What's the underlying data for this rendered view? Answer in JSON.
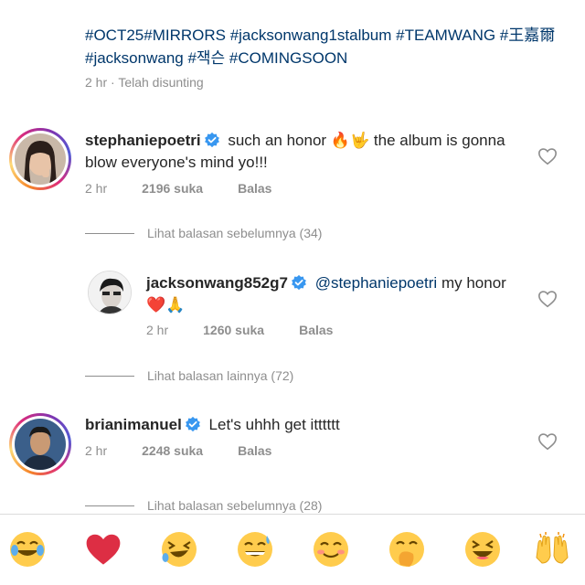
{
  "post": {
    "caption_hashtags": "#OCT25#MIRRORS #jacksonwang1stalbum #TEAMWANG #王嘉爾 #jacksonwang #잭슨 #COMINGSOON",
    "meta": "2 hr · Telah disunting"
  },
  "comments": [
    {
      "username": "stephaniepoetri",
      "text_before": "such an honor",
      "emoji_inline": "🔥🤟",
      "text_after": "the album is gonna blow everyone's mind yo!!!",
      "time": "2 hr",
      "likes": "2196 suka",
      "reply_label": "Balas"
    },
    {
      "username": "jacksonwang852g7",
      "mention": "@stephaniepoetri",
      "text": "my honor",
      "emoji_inline": "❤️🙏",
      "time": "2 hr",
      "likes": "1260 suka",
      "reply_label": "Balas"
    },
    {
      "username": "brianimanuel",
      "text": "Let's uhhh get itttttt",
      "time": "2 hr",
      "likes": "2248 suka",
      "reply_label": "Balas"
    }
  ],
  "view_replies": {
    "previous_1": "Lihat balasan sebelumnya (34)",
    "more": "Lihat balasan lainnya (72)",
    "previous_2": "Lihat balasan sebelumnya (28)"
  },
  "emoji_bar": [
    "😂",
    "❤️",
    "🤣",
    "😅",
    "😊",
    "🤭",
    "😆",
    "🙌"
  ],
  "colors": {
    "text": "#262626",
    "secondary": "#8e8e8e",
    "link": "#00376b",
    "verified": "#3897f0"
  }
}
